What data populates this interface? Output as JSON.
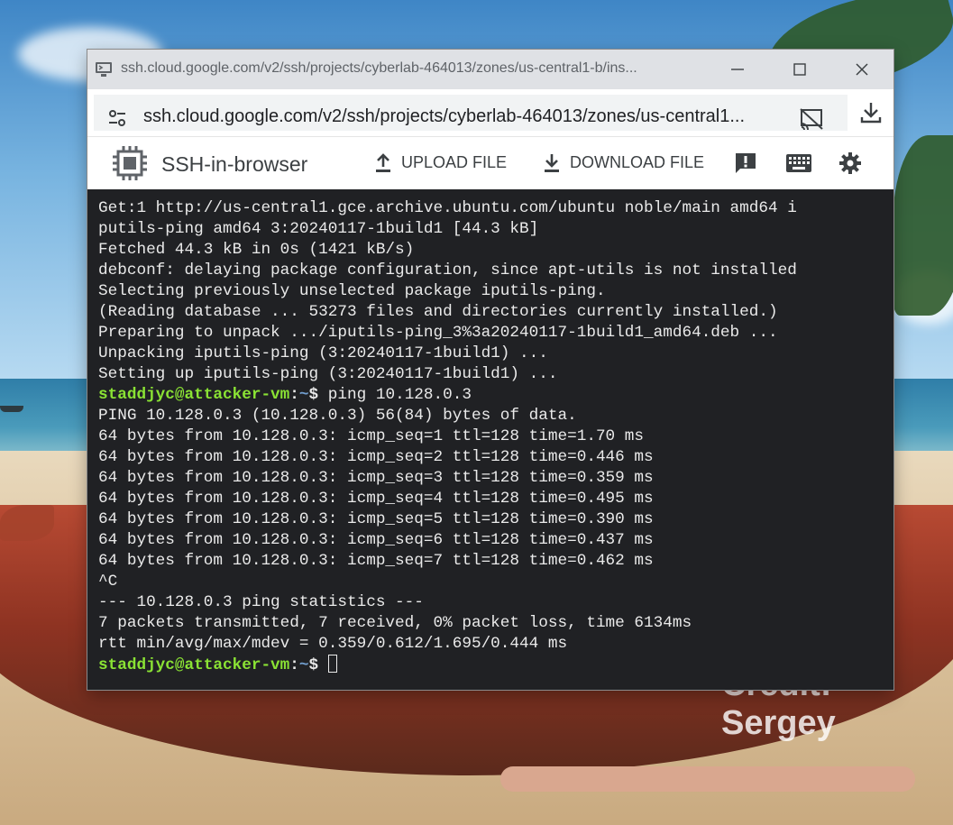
{
  "colors": {
    "prompt_user": "#8ae234",
    "prompt_path": "#729fcf",
    "terminal_bg": "#202124",
    "terminal_fg": "#eaeaea",
    "toolbar_bg": "#ffffff",
    "titlebar_bg": "#dfe1e5"
  },
  "window": {
    "title": "ssh.cloud.google.com/v2/ssh/projects/cyberlab-464013/zones/us-central1-b/ins...",
    "favicon": "monitor-icon",
    "controls": {
      "minimize": "—",
      "maximize": "☐",
      "close": "✕"
    }
  },
  "address_bar": {
    "url": "ssh.cloud.google.com/v2/ssh/projects/cyberlab-464013/zones/us-central1...",
    "icons": [
      "tune-icon",
      "cast-off-icon",
      "download-icon"
    ]
  },
  "toolbar": {
    "app_name": "SSH-in-browser",
    "logo_icon": "chip-icon",
    "upload_label": "UPLOAD FILE",
    "download_label": "DOWNLOAD FILE",
    "icons": [
      "upload-icon",
      "download-icon",
      "feedback-icon",
      "keyboard-icon",
      "settings-icon"
    ]
  },
  "terminal": {
    "prompt": {
      "user_host": "staddjyc@attacker-vm",
      "sep": ":",
      "path": "~",
      "symbol": "$ "
    },
    "lines": [
      "Get:1 http://us-central1.gce.archive.ubuntu.com/ubuntu noble/main amd64 i",
      "putils-ping amd64 3:20240117-1build1 [44.3 kB]",
      "Fetched 44.3 kB in 0s (1421 kB/s)",
      "debconf: delaying package configuration, since apt-utils is not installed",
      "Selecting previously unselected package iputils-ping.",
      "(Reading database ... 53273 files and directories currently installed.)",
      "Preparing to unpack .../iputils-ping_3%3a20240117-1build1_amd64.deb ...",
      "Unpacking iputils-ping (3:20240117-1build1) ...",
      "Setting up iputils-ping (3:20240117-1build1) ..."
    ],
    "command": "ping 10.128.0.3",
    "output": [
      "PING 10.128.0.3 (10.128.0.3) 56(84) bytes of data.",
      "64 bytes from 10.128.0.3: icmp_seq=1 ttl=128 time=1.70 ms",
      "64 bytes from 10.128.0.3: icmp_seq=2 ttl=128 time=0.446 ms",
      "64 bytes from 10.128.0.3: icmp_seq=3 ttl=128 time=0.359 ms",
      "64 bytes from 10.128.0.3: icmp_seq=4 ttl=128 time=0.495 ms",
      "64 bytes from 10.128.0.3: icmp_seq=5 ttl=128 time=0.390 ms",
      "64 bytes from 10.128.0.3: icmp_seq=6 ttl=128 time=0.437 ms",
      "64 bytes from 10.128.0.3: icmp_seq=7 ttl=128 time=0.462 ms",
      "^C",
      "--- 10.128.0.3 ping statistics ---",
      "7 packets transmitted, 7 received, 0% packet loss, time 6134ms",
      "rtt min/avg/max/mdev = 0.359/0.612/1.695/0.444 ms"
    ]
  },
  "wallpaper": {
    "watermark": "Credit: Sergey"
  }
}
